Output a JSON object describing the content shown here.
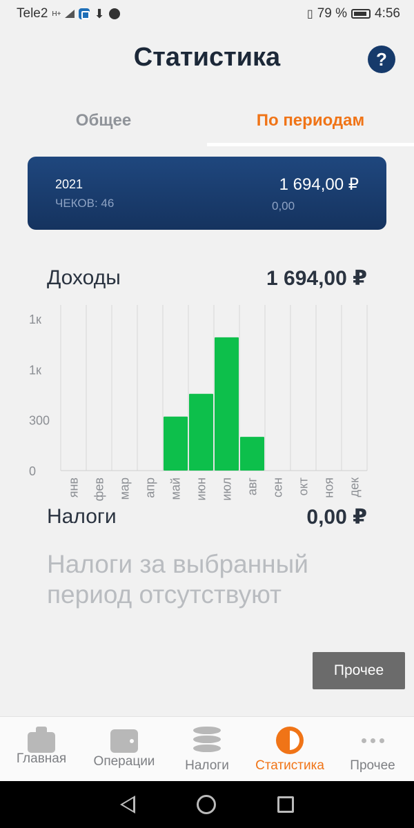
{
  "status_bar": {
    "carrier": "Tele2",
    "signal_text": "H+",
    "battery": "79 %",
    "time": "4:56"
  },
  "header": {
    "title": "Статистика",
    "help_label": "?"
  },
  "tabs": [
    {
      "label": "Общее",
      "active": false
    },
    {
      "label": "По периодам",
      "active": true
    }
  ],
  "summary_card": {
    "year": "2021",
    "checks": "ЧЕКОВ: 46",
    "amount": "1 694,00 ₽",
    "sub_amount": "0,00"
  },
  "income": {
    "label": "Доходы",
    "amount": "1 694,00 ₽"
  },
  "chart_data": {
    "type": "bar",
    "categories": [
      "янв",
      "фев",
      "мар",
      "апр",
      "май",
      "июн",
      "июл",
      "авг",
      "сен",
      "окт",
      "ноя",
      "дек"
    ],
    "values": [
      0,
      0,
      0,
      0,
      320,
      455,
      790,
      200,
      0,
      0,
      0,
      0
    ],
    "yticks": [
      {
        "value": 0,
        "label": "0"
      },
      {
        "value": 300,
        "label": "300"
      },
      {
        "value": 600,
        "label": "1к"
      },
      {
        "value": 900,
        "label": "1к"
      }
    ],
    "ylim": [
      0,
      900
    ],
    "grid": true,
    "bar_color": "#0dbf4b"
  },
  "taxes": {
    "label": "Налоги",
    "amount": "0,00 ₽",
    "empty_message": "Налоги за выбранный период отсутствуют"
  },
  "other_button": {
    "label": "Прочее"
  },
  "bottom_nav": [
    {
      "label": "Главная",
      "icon": "briefcase-icon",
      "active": false
    },
    {
      "label": "Операции",
      "icon": "wallet-icon",
      "active": false
    },
    {
      "label": "Налоги",
      "icon": "coins-icon",
      "active": false
    },
    {
      "label": "Статистика",
      "icon": "pie-chart-icon",
      "active": true
    },
    {
      "label": "Прочее",
      "icon": "more-dots-icon",
      "active": false
    }
  ],
  "colors": {
    "accent": "#f07417",
    "card_bg": "#1d4279",
    "bar": "#0dbf4b",
    "help_bg": "#163a6b"
  }
}
